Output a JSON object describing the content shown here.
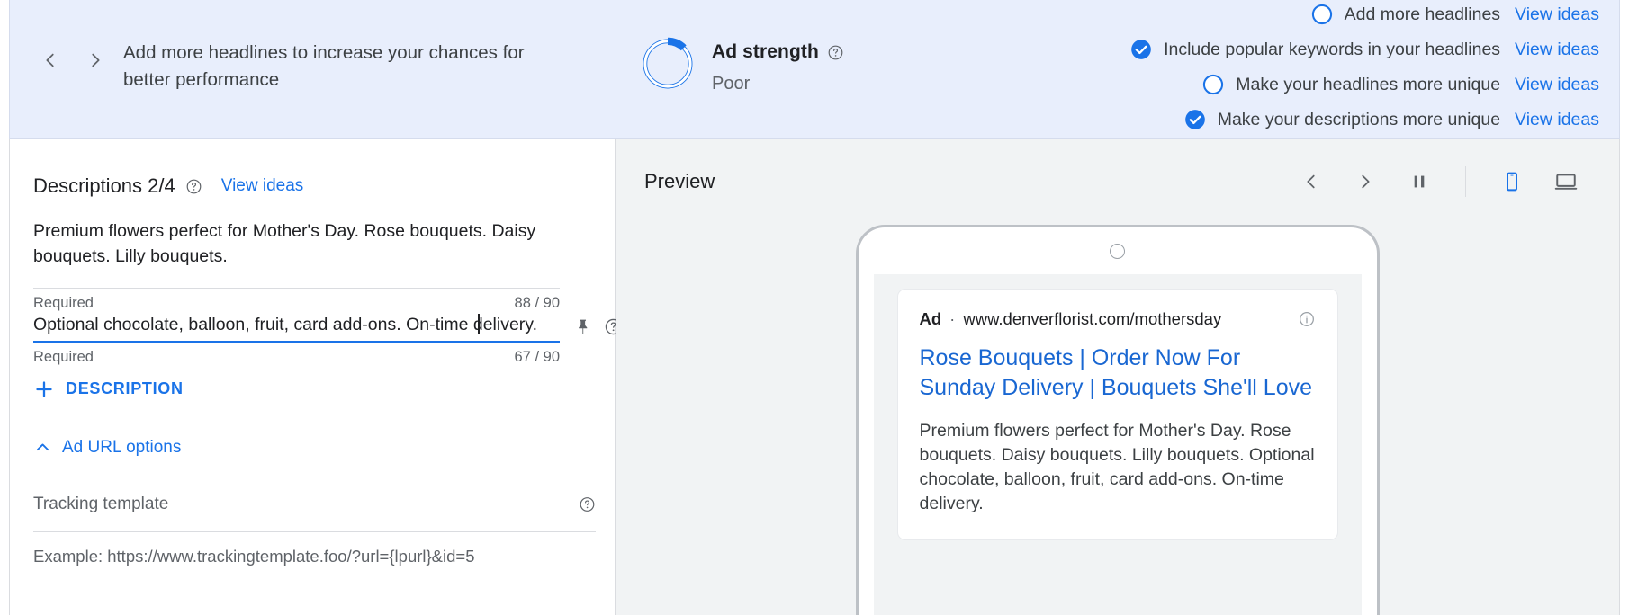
{
  "banner": {
    "message": "Add more headlines to increase your chances for better performance",
    "prev_arrow": "chevron-left-icon",
    "next_arrow": "chevron-right-icon",
    "ad_strength": {
      "title": "Ad strength",
      "value": "Poor",
      "help": "help-icon",
      "ring_percent": 12,
      "ring_color": "#1a73e8",
      "track_color": "#ffffff"
    },
    "checklist": [
      {
        "label": "Add more headlines",
        "link": "View ideas",
        "done": false
      },
      {
        "label": "Include popular keywords in your headlines",
        "link": "View ideas",
        "done": true
      },
      {
        "label": "Make your headlines more unique",
        "link": "View ideas",
        "done": false
      },
      {
        "label": "Make your descriptions more unique",
        "link": "View ideas",
        "done": true
      }
    ]
  },
  "descriptions": {
    "title": "Descriptions 2/4",
    "help": "help-icon",
    "view_ideas": "View ideas",
    "items": [
      {
        "text": "Premium flowers perfect for Mother's Day. Rose bouquets. Daisy bouquets. Lilly bouquets.",
        "required_label": "Required",
        "counter": "88 / 90"
      },
      {
        "text": "Optional chocolate, balloon, fruit, card add-ons. On-time delivery.",
        "required_label": "Required",
        "counter": "67 / 90"
      }
    ],
    "add_button": "DESCRIPTION",
    "add_icon": "plus-icon",
    "pin_icon": "pin-icon",
    "row_help_icon": "help-icon"
  },
  "ad_url_options": {
    "label": "Ad URL options",
    "chevron": "chevron-up-icon",
    "tracking_template_label": "Tracking template",
    "tracking_help": "help-icon",
    "tracking_example": "Example: https://www.trackingtemplate.foo/?url={lpurl}&id=5"
  },
  "preview": {
    "title": "Preview",
    "controls": [
      {
        "name": "prev",
        "icon": "chevron-left-icon"
      },
      {
        "name": "next",
        "icon": "chevron-right-icon"
      },
      {
        "name": "pause",
        "icon": "pause-icon"
      },
      {
        "name": "mobile",
        "icon": "mobile-icon",
        "active": true
      },
      {
        "name": "desktop",
        "icon": "desktop-icon",
        "active": false
      }
    ],
    "ad": {
      "badge": "Ad",
      "separator": "·",
      "url": "www.denverflorist.com/mothersday",
      "info_icon": "info-icon",
      "headline": "Rose Bouquets | Order Now For Sunday Delivery | Bouquets She'll Love",
      "description": "Premium flowers perfect for Mother's Day. Rose bouquets. Daisy bouquets. Lilly bouquets. Optional chocolate, balloon, fruit, card add-ons. On-time delivery."
    }
  },
  "colors": {
    "accent": "#1a73e8",
    "banner_bg": "#e8eefc",
    "text_primary": "#202124",
    "text_secondary": "#5f6368",
    "link": "#1967d2"
  }
}
